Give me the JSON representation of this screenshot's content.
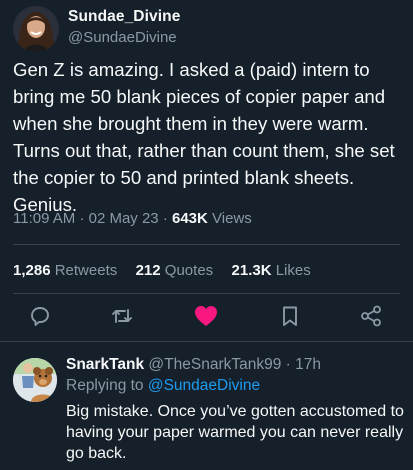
{
  "tweet": {
    "author": {
      "display_name": "Sundae_Divine",
      "handle": "@SundaeDivine"
    },
    "text": "Gen Z is amazing. I asked a (paid) intern to bring me 50 blank pieces of copier paper and when she brought them in they were warm. Turns out that, rather than count them, she set the copier to 50 and printed blank sheets. Genius.",
    "time": "11:09 AM",
    "date": "02 May 23",
    "separator": "·",
    "views_count": "643K",
    "views_label": "Views",
    "stats": {
      "retweets_count": "1,286",
      "retweets_label": "Retweets",
      "quotes_count": "212",
      "quotes_label": "Quotes",
      "likes_count": "21.3K",
      "likes_label": "Likes"
    },
    "actions": {
      "reply_icon": "reply-icon",
      "retweet_icon": "retweet-icon",
      "like_icon": "heart-icon",
      "bookmark_icon": "bookmark-icon",
      "share_icon": "share-icon",
      "liked": true
    }
  },
  "reply": {
    "display_name": "SnarkTank",
    "handle": "@TheSnarkTank99",
    "separator": "·",
    "age": "17h",
    "replying_to_label": "Replying to",
    "replying_to_handle": "@SundaeDivine",
    "text": "Big mistake. Once you’ve gotten accustomed to having your paper warmed you can never really go back."
  },
  "colors": {
    "background": "#15202b",
    "text_primary": "#f7f9f9",
    "text_secondary": "#8b98a5",
    "accent_blue": "#1d9bf0",
    "like_pink": "#f91880",
    "divider": "#38444d"
  }
}
